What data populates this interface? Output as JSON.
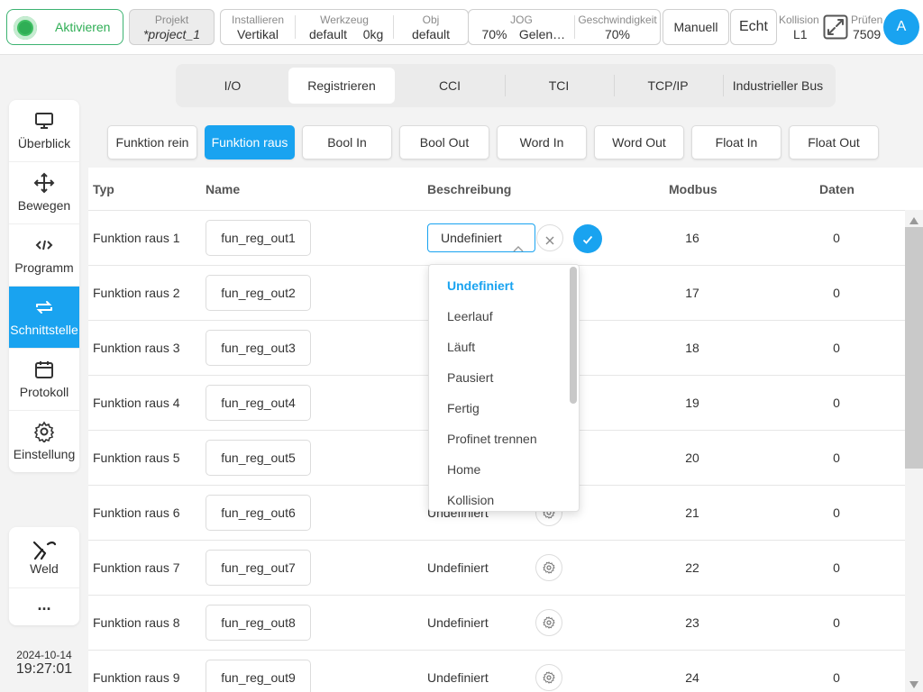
{
  "topbar": {
    "activate_label": "Aktivieren",
    "project": {
      "title": "Projekt",
      "value": "*project_1"
    },
    "install": {
      "title": "Installieren",
      "value": "Vertikal"
    },
    "tool": {
      "title": "Werkzeug",
      "name": "default",
      "weight": "0kg"
    },
    "obj": {
      "title": "Obj",
      "value": "default"
    },
    "jog": {
      "title": "JOG",
      "percent": "70%",
      "mode": "Gelen…"
    },
    "speed": {
      "title": "Geschwindigkeit",
      "value": "70%"
    },
    "manual_label": "Manuell",
    "real_label": "Echt",
    "collision": {
      "title": "Kollision",
      "value": "L1"
    },
    "check": {
      "title": "Prüfen",
      "value": "7509"
    },
    "avatar_letter": "A"
  },
  "nav": {
    "items": [
      {
        "label": "Überblick",
        "icon": "monitor-icon"
      },
      {
        "label": "Bewegen",
        "icon": "move-icon"
      },
      {
        "label": "Programm",
        "icon": "code-icon"
      },
      {
        "label": "Schnittstelle",
        "icon": "swap-icon"
      },
      {
        "label": "Protokoll",
        "icon": "calendar-icon"
      },
      {
        "label": "Einstellung",
        "icon": "gear-icon"
      }
    ],
    "weld_label": "Weld",
    "more_label": "...",
    "date": "2024-10-14",
    "time": "19:27:01"
  },
  "tabs": [
    "I/O",
    "Registrieren",
    "CCI",
    "TCI",
    "TCP/IP",
    "Industrieller Bus"
  ],
  "subtabs": [
    "Funktion rein",
    "Funktion raus",
    "Bool In",
    "Bool Out",
    "Word In",
    "Word Out",
    "Float In",
    "Float Out"
  ],
  "table": {
    "headers": {
      "typ": "Typ",
      "name": "Name",
      "desc": "Beschreibung",
      "modbus": "Modbus",
      "data": "Daten"
    },
    "rows": [
      {
        "typ": "Funktion raus 1",
        "name": "fun_reg_out1",
        "desc": "Undefiniert",
        "modbus": "16",
        "data": "0"
      },
      {
        "typ": "Funktion raus 2",
        "name": "fun_reg_out2",
        "desc": "",
        "modbus": "17",
        "data": "0"
      },
      {
        "typ": "Funktion raus 3",
        "name": "fun_reg_out3",
        "desc": "",
        "modbus": "18",
        "data": "0"
      },
      {
        "typ": "Funktion raus 4",
        "name": "fun_reg_out4",
        "desc": "",
        "modbus": "19",
        "data": "0"
      },
      {
        "typ": "Funktion raus 5",
        "name": "fun_reg_out5",
        "desc": "",
        "modbus": "20",
        "data": "0"
      },
      {
        "typ": "Funktion raus 6",
        "name": "fun_reg_out6",
        "desc": "Undefiniert",
        "modbus": "21",
        "data": "0"
      },
      {
        "typ": "Funktion raus 7",
        "name": "fun_reg_out7",
        "desc": "Undefiniert",
        "modbus": "22",
        "data": "0"
      },
      {
        "typ": "Funktion raus 8",
        "name": "fun_reg_out8",
        "desc": "Undefiniert",
        "modbus": "23",
        "data": "0"
      },
      {
        "typ": "Funktion raus 9",
        "name": "fun_reg_out9",
        "desc": "Undefiniert",
        "modbus": "24",
        "data": "0"
      }
    ]
  },
  "dropdown": {
    "options": [
      "Undefiniert",
      "Leerlauf",
      "Läuft",
      "Pausiert",
      "Fertig",
      "Profinet trennen",
      "Home",
      "Kollision"
    ],
    "selected": "Undefiniert"
  },
  "colors": {
    "accent": "#19a3f0",
    "active_green": "#2fae55"
  }
}
